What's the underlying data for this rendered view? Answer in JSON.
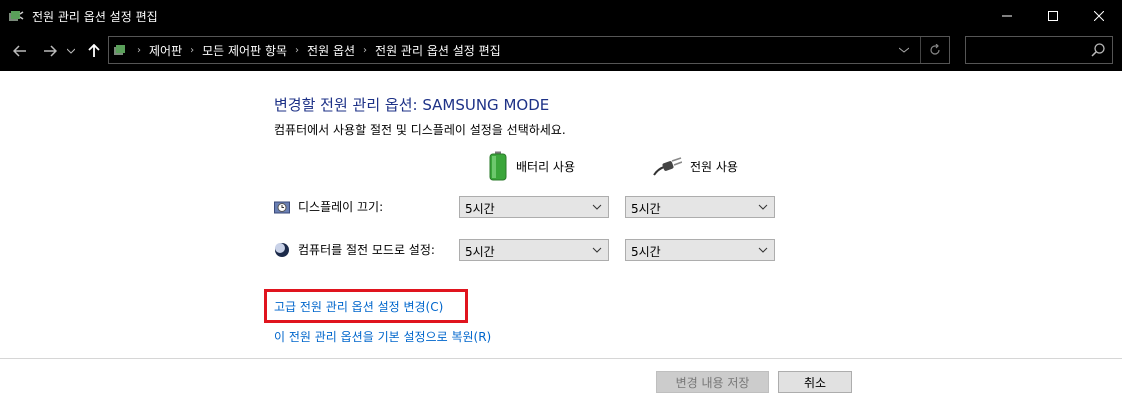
{
  "window": {
    "title": "전원 관리 옵션 설정 편집"
  },
  "breadcrumb": [
    "제어판",
    "모든 제어판 항목",
    "전원 옵션",
    "전원 관리 옵션 설정 편집"
  ],
  "main": {
    "heading": "변경할 전원 관리 옵션: SAMSUNG MODE",
    "subtext": "컴퓨터에서 사용할 절전 및 디스플레이 설정을 선택하세요.",
    "columns": {
      "battery": "배터리 사용",
      "plugged": "전원 사용"
    },
    "rows": [
      {
        "label": "디스플레이 끄기:",
        "battery_value": "5시간",
        "plugged_value": "5시간"
      },
      {
        "label": "컴퓨터를 절전 모드로 설정:",
        "battery_value": "5시간",
        "plugged_value": "5시간"
      }
    ],
    "links": {
      "advanced": "고급 전원 관리 옵션 설정 변경(C)",
      "restore": "이 전원 관리 옵션을 기본 설정으로 복원(R)"
    }
  },
  "buttons": {
    "save": "변경 내용 저장",
    "cancel": "취소"
  },
  "colors": {
    "highlight": "#e0141e",
    "heading": "#1e3287",
    "link": "#0066cc"
  }
}
